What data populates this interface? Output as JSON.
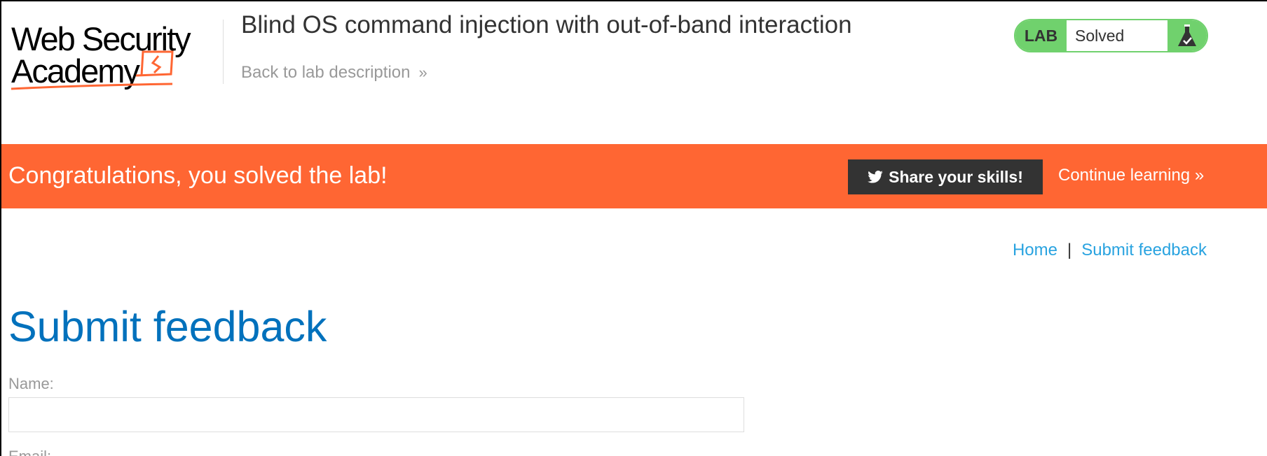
{
  "header": {
    "logo_text": "Web Security Academy",
    "title": "Blind OS command injection with out-of-band interaction",
    "back_link": "Back to lab description",
    "badge": {
      "label": "LAB",
      "status": "Solved",
      "icon": "flask-check-icon"
    }
  },
  "banner": {
    "message": "Congratulations, you solved the lab!",
    "share_button": "Share your skills!",
    "continue_link": "Continue learning"
  },
  "nav": {
    "home": "Home",
    "separator": "|",
    "submit_feedback": "Submit feedback"
  },
  "main": {
    "heading": "Submit feedback",
    "name_label": "Name:",
    "name_value": "",
    "email_label": "Email:"
  },
  "colors": {
    "brand_orange": "#ff6633",
    "lab_green": "#70d16d",
    "link_blue": "#29a3e0",
    "heading_blue": "#0071bc"
  }
}
